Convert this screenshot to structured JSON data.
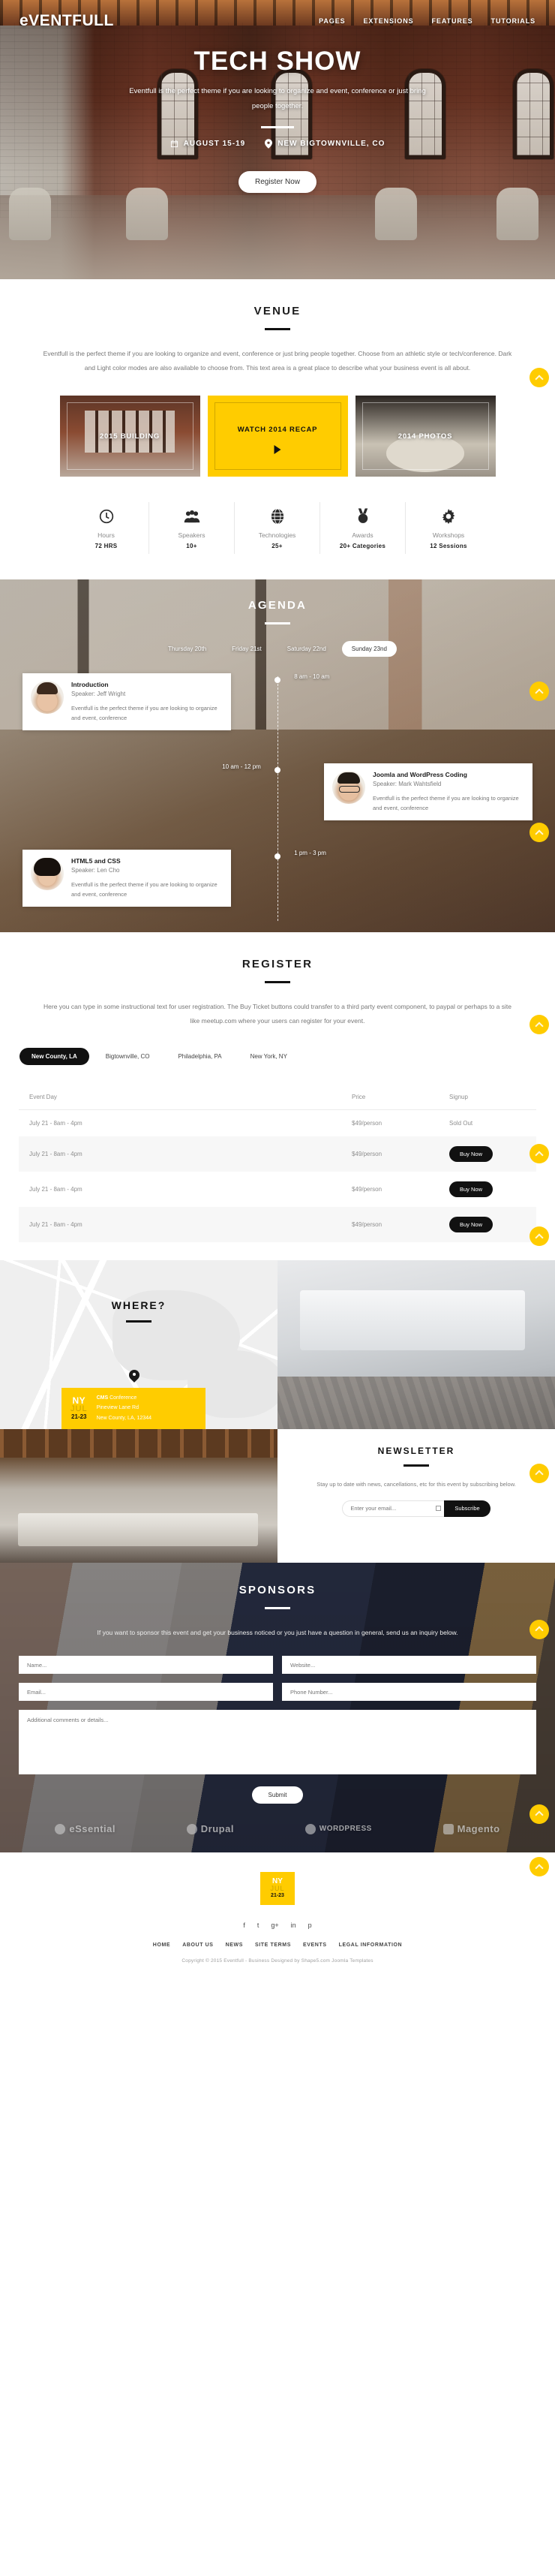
{
  "nav": {
    "logo": "eVENTFULL",
    "links": [
      "PAGES",
      "EXTENSIONS",
      "FEATURES",
      "TUTORIALS"
    ]
  },
  "hero": {
    "title": "TECH SHOW",
    "subtitle": "Eventfull is the perfect theme if you are looking to organize and event, conference or just bring people together.",
    "date": "AUGUST 15-19",
    "location": "NEW BIGTOWNVILLE, CO",
    "cta": "Register Now",
    "calendar_icon": "calendar-icon",
    "pin_icon": "map-pin-icon"
  },
  "venue": {
    "title": "VENUE",
    "description": "Eventfull is the perfect theme if you are looking to organize and event, conference or just bring people together. Choose from an athletic style or tech/conference. Dark and Light color modes are also available to choose from. This text area is a great place to describe what your business event is all about.",
    "cards": [
      {
        "label": "2015 BUILDING"
      },
      {
        "label": "WATCH 2014 RECAP"
      },
      {
        "label": "2014 PHOTOS"
      }
    ],
    "accent_color": "#FFCC00"
  },
  "stats": [
    {
      "icon": "clock-icon",
      "label": "Hours",
      "value": "72 HRS"
    },
    {
      "icon": "people-icon",
      "label": "Speakers",
      "value": "10+"
    },
    {
      "icon": "globe-icon",
      "label": "Technologies",
      "value": "25+"
    },
    {
      "icon": "medal-icon",
      "label": "Awards",
      "value": "20+ Categories"
    },
    {
      "icon": "gear-icon",
      "label": "Workshops",
      "value": "12 Sessions"
    }
  ],
  "agenda": {
    "title": "AGENDA",
    "days": [
      "Thursday 20th",
      "Friday 21st",
      "Saturday 22nd",
      "Sunday 23nd"
    ],
    "active_day": "Sunday 23nd",
    "items": [
      {
        "time": "8 am - 10 am",
        "side": "left",
        "title": "Introduction",
        "speaker": "Speaker: Jeff Wright",
        "text": "Eventfull is the perfect theme if you are looking to organize and event, conference"
      },
      {
        "time": "10 am - 12 pm",
        "side": "right",
        "title": "Joomla and WordPress Coding",
        "speaker": "Speaker: Mark Wahtsfield",
        "text": "Eventfull is the perfect theme if you are looking to organize and event, conference"
      },
      {
        "time": "1 pm - 3 pm",
        "side": "left",
        "title": "HTML5 and CSS",
        "speaker": "Speaker: Len Cho",
        "text": "Eventfull is the perfect theme if you are looking to organize and event, conference"
      }
    ]
  },
  "register": {
    "title": "REGISTER",
    "description": "Here you can type in some instructional text for user registration. The Buy Ticket buttons could transfer to a third party event component, to paypal or perhaps to a site like meetup.com where your users can register for your event.",
    "city_tabs": [
      "New County, LA",
      "Bigtownville, CO",
      "Philadelphia, PA",
      "New York, NY"
    ],
    "active_city": "New County, LA",
    "columns": [
      "Event Day",
      "Price",
      "Signup"
    ],
    "rows": [
      {
        "day": "July 21 - 8am - 4pm",
        "price": "$49/person",
        "signup": "Sold Out",
        "sold_out": true
      },
      {
        "day": "July 21 - 8am - 4pm",
        "price": "$49/person",
        "signup": "Buy Now",
        "sold_out": false
      },
      {
        "day": "July 21 - 8am - 4pm",
        "price": "$49/person",
        "signup": "Buy Now",
        "sold_out": false
      },
      {
        "day": "July 21 - 8am - 4pm",
        "price": "$49/person",
        "signup": "Buy Now",
        "sold_out": false
      }
    ]
  },
  "where": {
    "title": "WHERE?",
    "badge": {
      "ny": "NY",
      "month": "JUL",
      "days": "21-23"
    },
    "event_name_bold": "CMS",
    "event_name_rest": " Conference",
    "address_line1": "Pineview Lane Rd",
    "address_line2": "New County, LA, 12344"
  },
  "newsletter": {
    "title": "NEWSLETTER",
    "description": "Stay up to date with news, cancellations, etc for this event by subscribing below.",
    "placeholder": "Enter your email...",
    "button": "Subscribe",
    "input_value": ""
  },
  "sponsors": {
    "title": "SPONSORS",
    "description": "If you want to sponsor this event and get your business noticed or you just have a question in general, send us an inquiry below.",
    "fields": {
      "name": "Name...",
      "website": "Website...",
      "email": "Email...",
      "phone": "Phone Number...",
      "comments": "Additional comments or details..."
    },
    "submit": "Submit",
    "logos": [
      "eSsential",
      "Drupal",
      "WORDPRESS",
      "Magento"
    ]
  },
  "footer": {
    "badge": {
      "ny": "NY",
      "month": "JUL",
      "days": "21-23"
    },
    "social": [
      "f",
      "t",
      "g+",
      "in",
      "p"
    ],
    "links": [
      "HOME",
      "ABOUT US",
      "NEWS",
      "SITE TERMS",
      "EVENTS",
      "LEGAL INFORMATION"
    ],
    "copyright": "Copyright © 2015 Eventfull - Business Designed by Shape5.com Joomla Templates"
  },
  "scroll_top_icon": "chevron-up-icon"
}
